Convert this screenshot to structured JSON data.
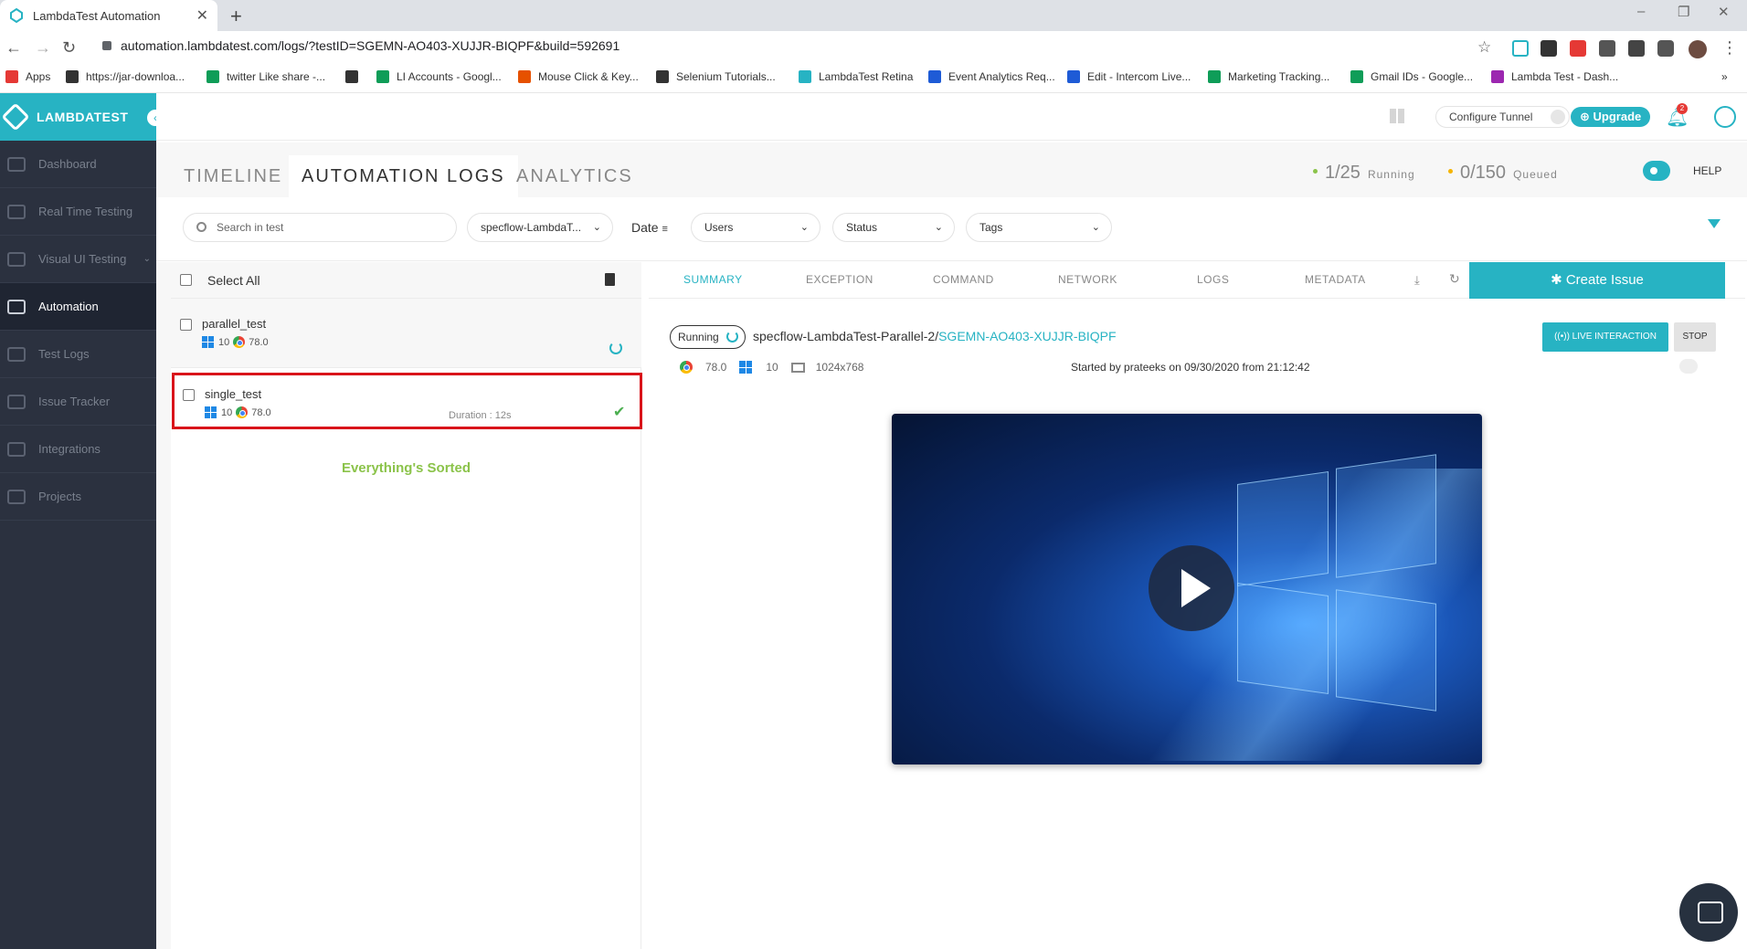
{
  "browser": {
    "tab_title": "LambdaTest Automation",
    "tab_close": "✕",
    "new_tab": "+",
    "url": "automation.lambdatest.com/logs/?testID=SGEMN-AO403-XUJJR-BIQPF&build=592691",
    "window_controls": {
      "minimize": "–",
      "maximize": "❐",
      "close": "✕"
    },
    "bookmarks": [
      {
        "label": "Apps",
        "color": "#e53935"
      },
      {
        "label": "https://jar-downloa...",
        "color": "#333333"
      },
      {
        "label": "twitter Like share -...",
        "color": "#0f9d58"
      },
      {
        "label": "",
        "color": "#333333"
      },
      {
        "label": "LI Accounts - Googl...",
        "color": "#0f9d58"
      },
      {
        "label": "Mouse Click & Key...",
        "color": "#e65100"
      },
      {
        "label": "Selenium Tutorials...",
        "color": "#333333"
      },
      {
        "label": "LambdaTest Retina",
        "color": "#27b3c3"
      },
      {
        "label": "Event Analytics Req...",
        "color": "#1e5bd6"
      },
      {
        "label": "Edit - Intercom Live...",
        "color": "#1e5bd6"
      },
      {
        "label": "Marketing Tracking...",
        "color": "#0f9d58"
      },
      {
        "label": "Gmail IDs - Google...",
        "color": "#0f9d58"
      },
      {
        "label": "Lambda Test - Dash...",
        "color": "#9c27b0"
      }
    ],
    "bookmarks_more": "»"
  },
  "sidebar": {
    "brand": "LAMBDATEST",
    "items": [
      {
        "label": "Dashboard",
        "icon": "dashboard-icon"
      },
      {
        "label": "Real Time Testing",
        "icon": "clock-icon"
      },
      {
        "label": "Visual UI Testing",
        "icon": "monitor-icon"
      },
      {
        "label": "Automation",
        "icon": "robot-icon",
        "active": true
      },
      {
        "label": "Test Logs",
        "icon": "cube-icon"
      },
      {
        "label": "Issue Tracker",
        "icon": "bug-icon"
      },
      {
        "label": "Integrations",
        "icon": "integrations-icon"
      },
      {
        "label": "Projects",
        "icon": "folder-icon"
      }
    ]
  },
  "topbar": {
    "configure_tunnel": "Configure Tunnel",
    "upgrade": "⊕ Upgrade",
    "notification_count": "2"
  },
  "subnav": {
    "tabs": [
      "TIMELINE",
      "AUTOMATION LOGS",
      "ANALYTICS"
    ],
    "running_count": "1/25",
    "running_label": "Running",
    "queued_count": "0/150",
    "queued_label": "Queued",
    "help": "HELP",
    "running_color": "#8bc34a",
    "queued_color": "#f5b400"
  },
  "filters": {
    "search_placeholder": "Search in test",
    "build": "specflow-LambdaT...",
    "date": "Date",
    "users": "Users",
    "status": "Status",
    "tags": "Tags"
  },
  "tests": {
    "select_all": "Select All",
    "items": [
      {
        "name": "parallel_test",
        "os": "10",
        "browser": "78.0",
        "duration": "",
        "state": "running"
      },
      {
        "name": "single_test",
        "os": "10",
        "browser": "78.0",
        "duration": "Duration : 12s",
        "state": "passed"
      }
    ],
    "empty_message": "Everything's Sorted"
  },
  "detail": {
    "tabs": [
      "SUMMARY",
      "EXCEPTION",
      "COMMAND",
      "NETWORK",
      "LOGS",
      "METADATA"
    ],
    "create_issue": "Create Issue",
    "status": "Running",
    "build_prefix": "specflow-LambdaTest-Parallel-2/",
    "test_id": "SGEMN-AO403-XUJJR-BIQPF",
    "live_interaction": "((•)) LIVE INTERACTION",
    "stop": "STOP",
    "browser_version": "78.0",
    "os_version": "10",
    "resolution": "1024x768",
    "started_by": "Started by prateeks on 09/30/2020 from 21:12:42"
  },
  "colors": {
    "accent": "#27b3c3",
    "sidebar": "#2b313f",
    "highlight": "#d9141a",
    "success": "#4caf50"
  }
}
